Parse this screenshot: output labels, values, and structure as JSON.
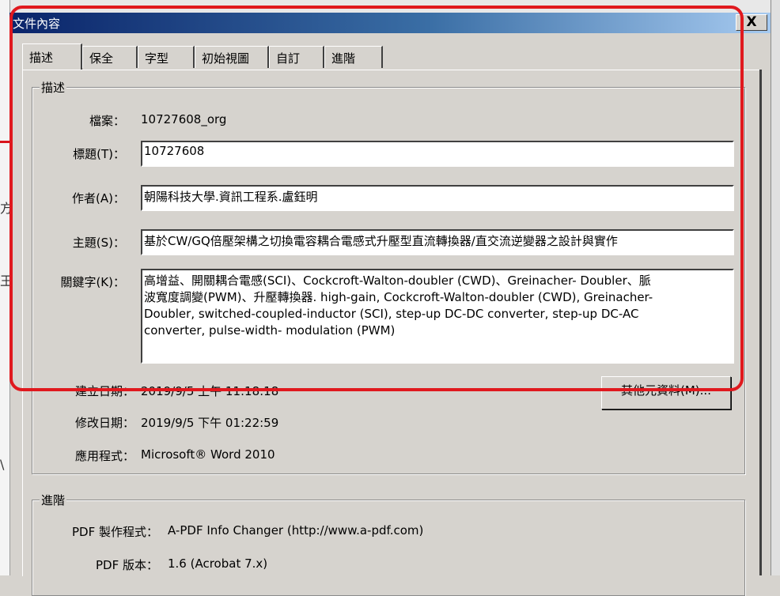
{
  "window": {
    "title": "文件內容",
    "close_label": "X"
  },
  "background": {
    "glyphs": [
      "方",
      "王",
      "\\"
    ]
  },
  "tabs": [
    {
      "label": "描述",
      "active": true
    },
    {
      "label": "保全",
      "active": false
    },
    {
      "label": "字型",
      "active": false
    },
    {
      "label": "初始視圖",
      "active": false
    },
    {
      "label": "自訂",
      "active": false
    },
    {
      "label": "進階",
      "active": false
    }
  ],
  "description": {
    "legend": "描述",
    "file": {
      "label": "檔案：",
      "value": "10727608_org"
    },
    "title": {
      "label": "標題(T)：",
      "value": "10727608"
    },
    "author": {
      "label": "作者(A)：",
      "value": "朝陽科技大學.資訊工程系.盧鈺明"
    },
    "subject": {
      "label": "主題(S)：",
      "value": "基於CW/GQ倍壓架構之切換電容耦合電感式升壓型直流轉換器/直交流逆變器之設計與實作"
    },
    "keywords": {
      "label": "關鍵字(K)：",
      "lines": [
        "高增益、開關耦合電感(SCI)、Cockcroft-Walton-doubler (CWD)、Greinacher- Doubler、脈",
        "波寬度調變(PWM)、升壓轉換器. high-gain, Cockcroft-Walton-doubler (CWD), Greinacher-",
        "Doubler, switched-coupled-inductor (SCI), step-up DC-DC converter, step-up DC-AC",
        "converter, pulse-width- modulation (PWM)"
      ]
    },
    "created": {
      "label": "建立日期：",
      "value": "2019/9/5 上午 11:18:18"
    },
    "modified": {
      "label": "修改日期：",
      "value": "2019/9/5 下午 01:22:59"
    },
    "application": {
      "label": "應用程式：",
      "value": "Microsoft® Word 2010"
    },
    "metadata_button": "其他元資料(M)..."
  },
  "advanced": {
    "legend": "進階",
    "producer": {
      "label": "PDF 製作程式：",
      "value": "A-PDF Info Changer (http://www.a-pdf.com)"
    },
    "version": {
      "label": "PDF 版本：",
      "value": "1.6 (Acrobat 7.x)"
    }
  },
  "colors": {
    "titlebar_start": "#0a246a",
    "highlight": "#e0191e",
    "dialog_bg": "#d6d3ce"
  }
}
